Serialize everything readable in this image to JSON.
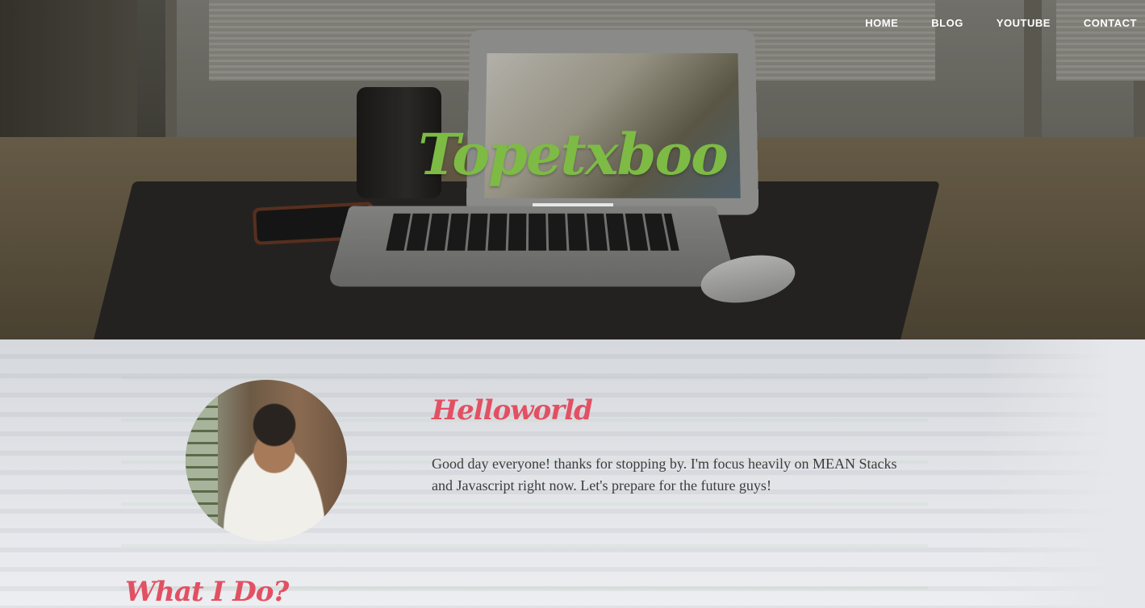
{
  "nav": {
    "items": [
      "HOME",
      "BLOG",
      "YOUTUBE",
      "CONTACT"
    ]
  },
  "hero": {
    "brand": "Topetxboo"
  },
  "about": {
    "heading": "Helloworld",
    "intro": "Good day everyone! thanks for stopping by. I'm focus heavily on MEAN Stacks and Javascript right now. Let's prepare for the future guys!",
    "next_heading": "What I Do?"
  },
  "colors": {
    "brand": "#7dbb44",
    "heading": "#e25063",
    "nav_text": "#ffffff",
    "body_text": "#3c3c3c"
  }
}
